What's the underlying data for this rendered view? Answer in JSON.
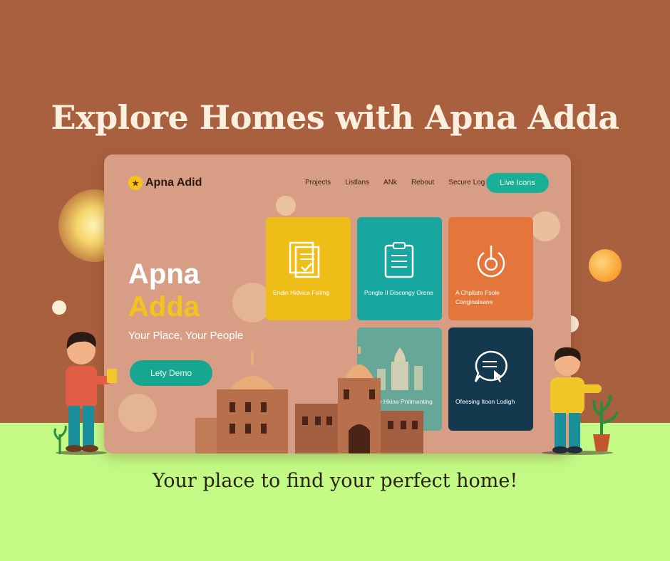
{
  "headline": "Explore Homes with Apna Adda",
  "tagline": "Your place to find your perfect home!",
  "mockup": {
    "logo_text": "Apna Adid",
    "nav": [
      "Projects",
      "Listlans",
      "ANk",
      "Rebout",
      "Secure Log"
    ],
    "live_button": "Live Icons",
    "hero_line1": "Apna",
    "hero_line2": "Adda",
    "hero_subtitle": "Your Place, Your People",
    "demo_button": "Lety Demo",
    "cards": [
      {
        "title": "Endin Hidvica Fsiling",
        "icon": "document-check-icon",
        "color": "#eebd18"
      },
      {
        "title": "Pongle II Discongy Orene",
        "icon": "clipboard-icon",
        "color": "#17a6a0"
      },
      {
        "title": "A Chpliato Fsole Conginaleane",
        "icon": "power-icon",
        "color": "#e5763b"
      },
      {
        "title": "Nuase Hkina Pnitmanting",
        "icon": "building-icon",
        "color": "#5aa89a"
      },
      {
        "title": "Ofeesing Itoon Lodigh",
        "icon": "chat-cursor-icon",
        "color": "#14384d"
      }
    ]
  }
}
